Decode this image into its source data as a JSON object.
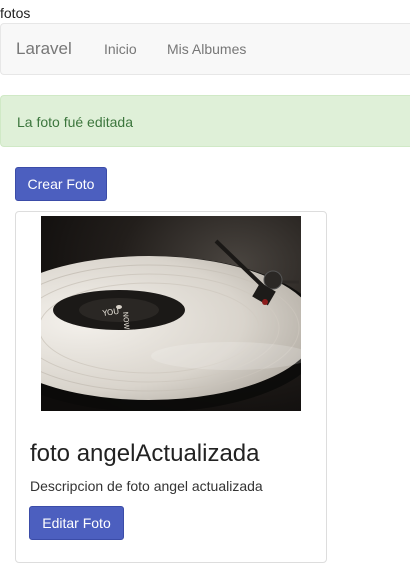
{
  "page": {
    "heading": "fotos"
  },
  "navbar": {
    "brand": "Laravel",
    "links": [
      {
        "label": "Inicio"
      },
      {
        "label": "Mis Albumes"
      }
    ]
  },
  "alert": {
    "message": "La foto fué editada"
  },
  "actions": {
    "create_label": "Crear Foto"
  },
  "photos": [
    {
      "title": "foto angelActualizada",
      "description": "Descripcion de foto angel actualizada",
      "edit_label": "Editar Foto",
      "image": "vinyl-record-turntable"
    }
  ]
}
